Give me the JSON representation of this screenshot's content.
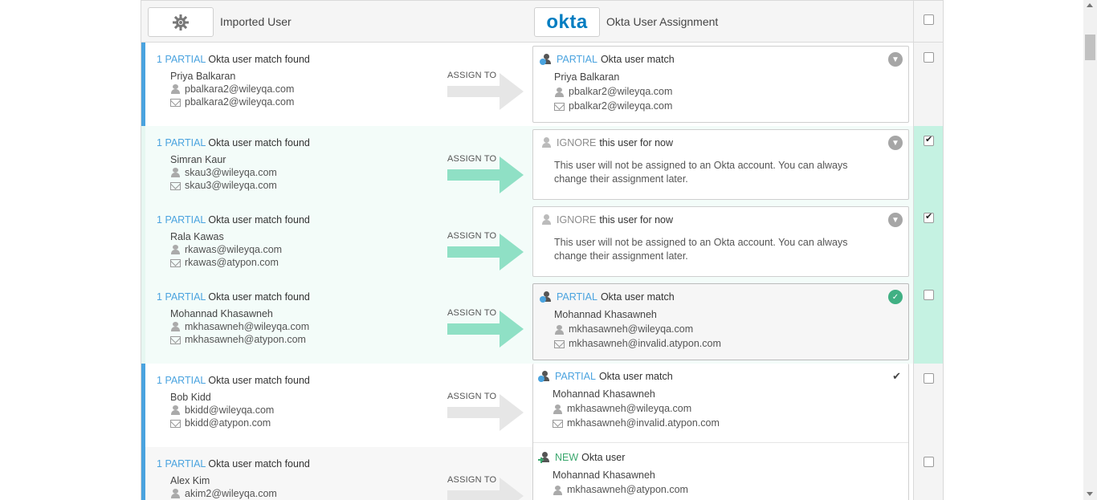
{
  "header": {
    "imported_title": "Imported User",
    "okta_logo": "okta",
    "assignment_title": "Okta User Assignment",
    "select_all_checked": false
  },
  "common": {
    "assign_to": "ASSIGN TO",
    "partial": "PARTIAL",
    "ignore": "IGNORE",
    "new": "NEW",
    "match_found_text": "Okta user match found",
    "okta_user_match": "Okta user match",
    "ignore_text": "this user for now",
    "ignore_body": "This user will not be assigned to an Okta account. You can always change their assignment later.",
    "new_text": "Okta user"
  },
  "rows": [
    {
      "count": "1",
      "name": "Priya Balkaran",
      "username": "pbalkara2@wileyqa.com",
      "email": "pbalkara2@wileyqa.com",
      "checked": false,
      "assignment": {
        "type": "PARTIAL",
        "name": "Priya Balkaran",
        "username": "pbalkar2@wileyqa.com",
        "email": "pbalkar2@wileyqa.com"
      }
    },
    {
      "count": "1",
      "name": "Simran Kaur",
      "username": "skau3@wileyqa.com",
      "email": "skau3@wileyqa.com",
      "checked": true,
      "assignment": {
        "type": "IGNORE"
      }
    },
    {
      "count": "1",
      "name": "Rala Kawas",
      "username": "rkawas@wileyqa.com",
      "email": "rkawas@atypon.com",
      "checked": true,
      "assignment": {
        "type": "IGNORE"
      }
    },
    {
      "count": "1",
      "name": "Mohannad Khasawneh",
      "username": "mkhasawneh@wileyqa.com",
      "email": "mkhasawneh@atypon.com",
      "checked": false,
      "assignment": {
        "type": "PARTIAL",
        "name": "Mohannad Khasawneh",
        "username": "mkhasawneh@wileyqa.com",
        "email": "mkhasawneh@invalid.atypon.com"
      }
    },
    {
      "count": "1",
      "name": "Bob Kidd",
      "username": "bkidd@wileyqa.com",
      "email": "bkidd@atypon.com",
      "checked": false,
      "options": [
        {
          "type": "PARTIAL",
          "name": "Mohannad Khasawneh",
          "username": "mkhasawneh@wileyqa.com",
          "email": "mkhasawneh@invalid.atypon.com"
        },
        {
          "type": "NEW",
          "name": "Mohannad Khasawneh",
          "username": "mkhasawneh@atypon.com"
        }
      ]
    },
    {
      "count": "1",
      "name": "Alex Kim",
      "username": "akim2@wileyqa.com",
      "checked": false
    }
  ],
  "colors": {
    "accent_blue": "#4aa3df",
    "selected_green": "#c5f2e2",
    "arrow_green": "#8fe0c5",
    "arrow_grey": "#e6e6e6",
    "okta_blue": "#007dc1"
  }
}
